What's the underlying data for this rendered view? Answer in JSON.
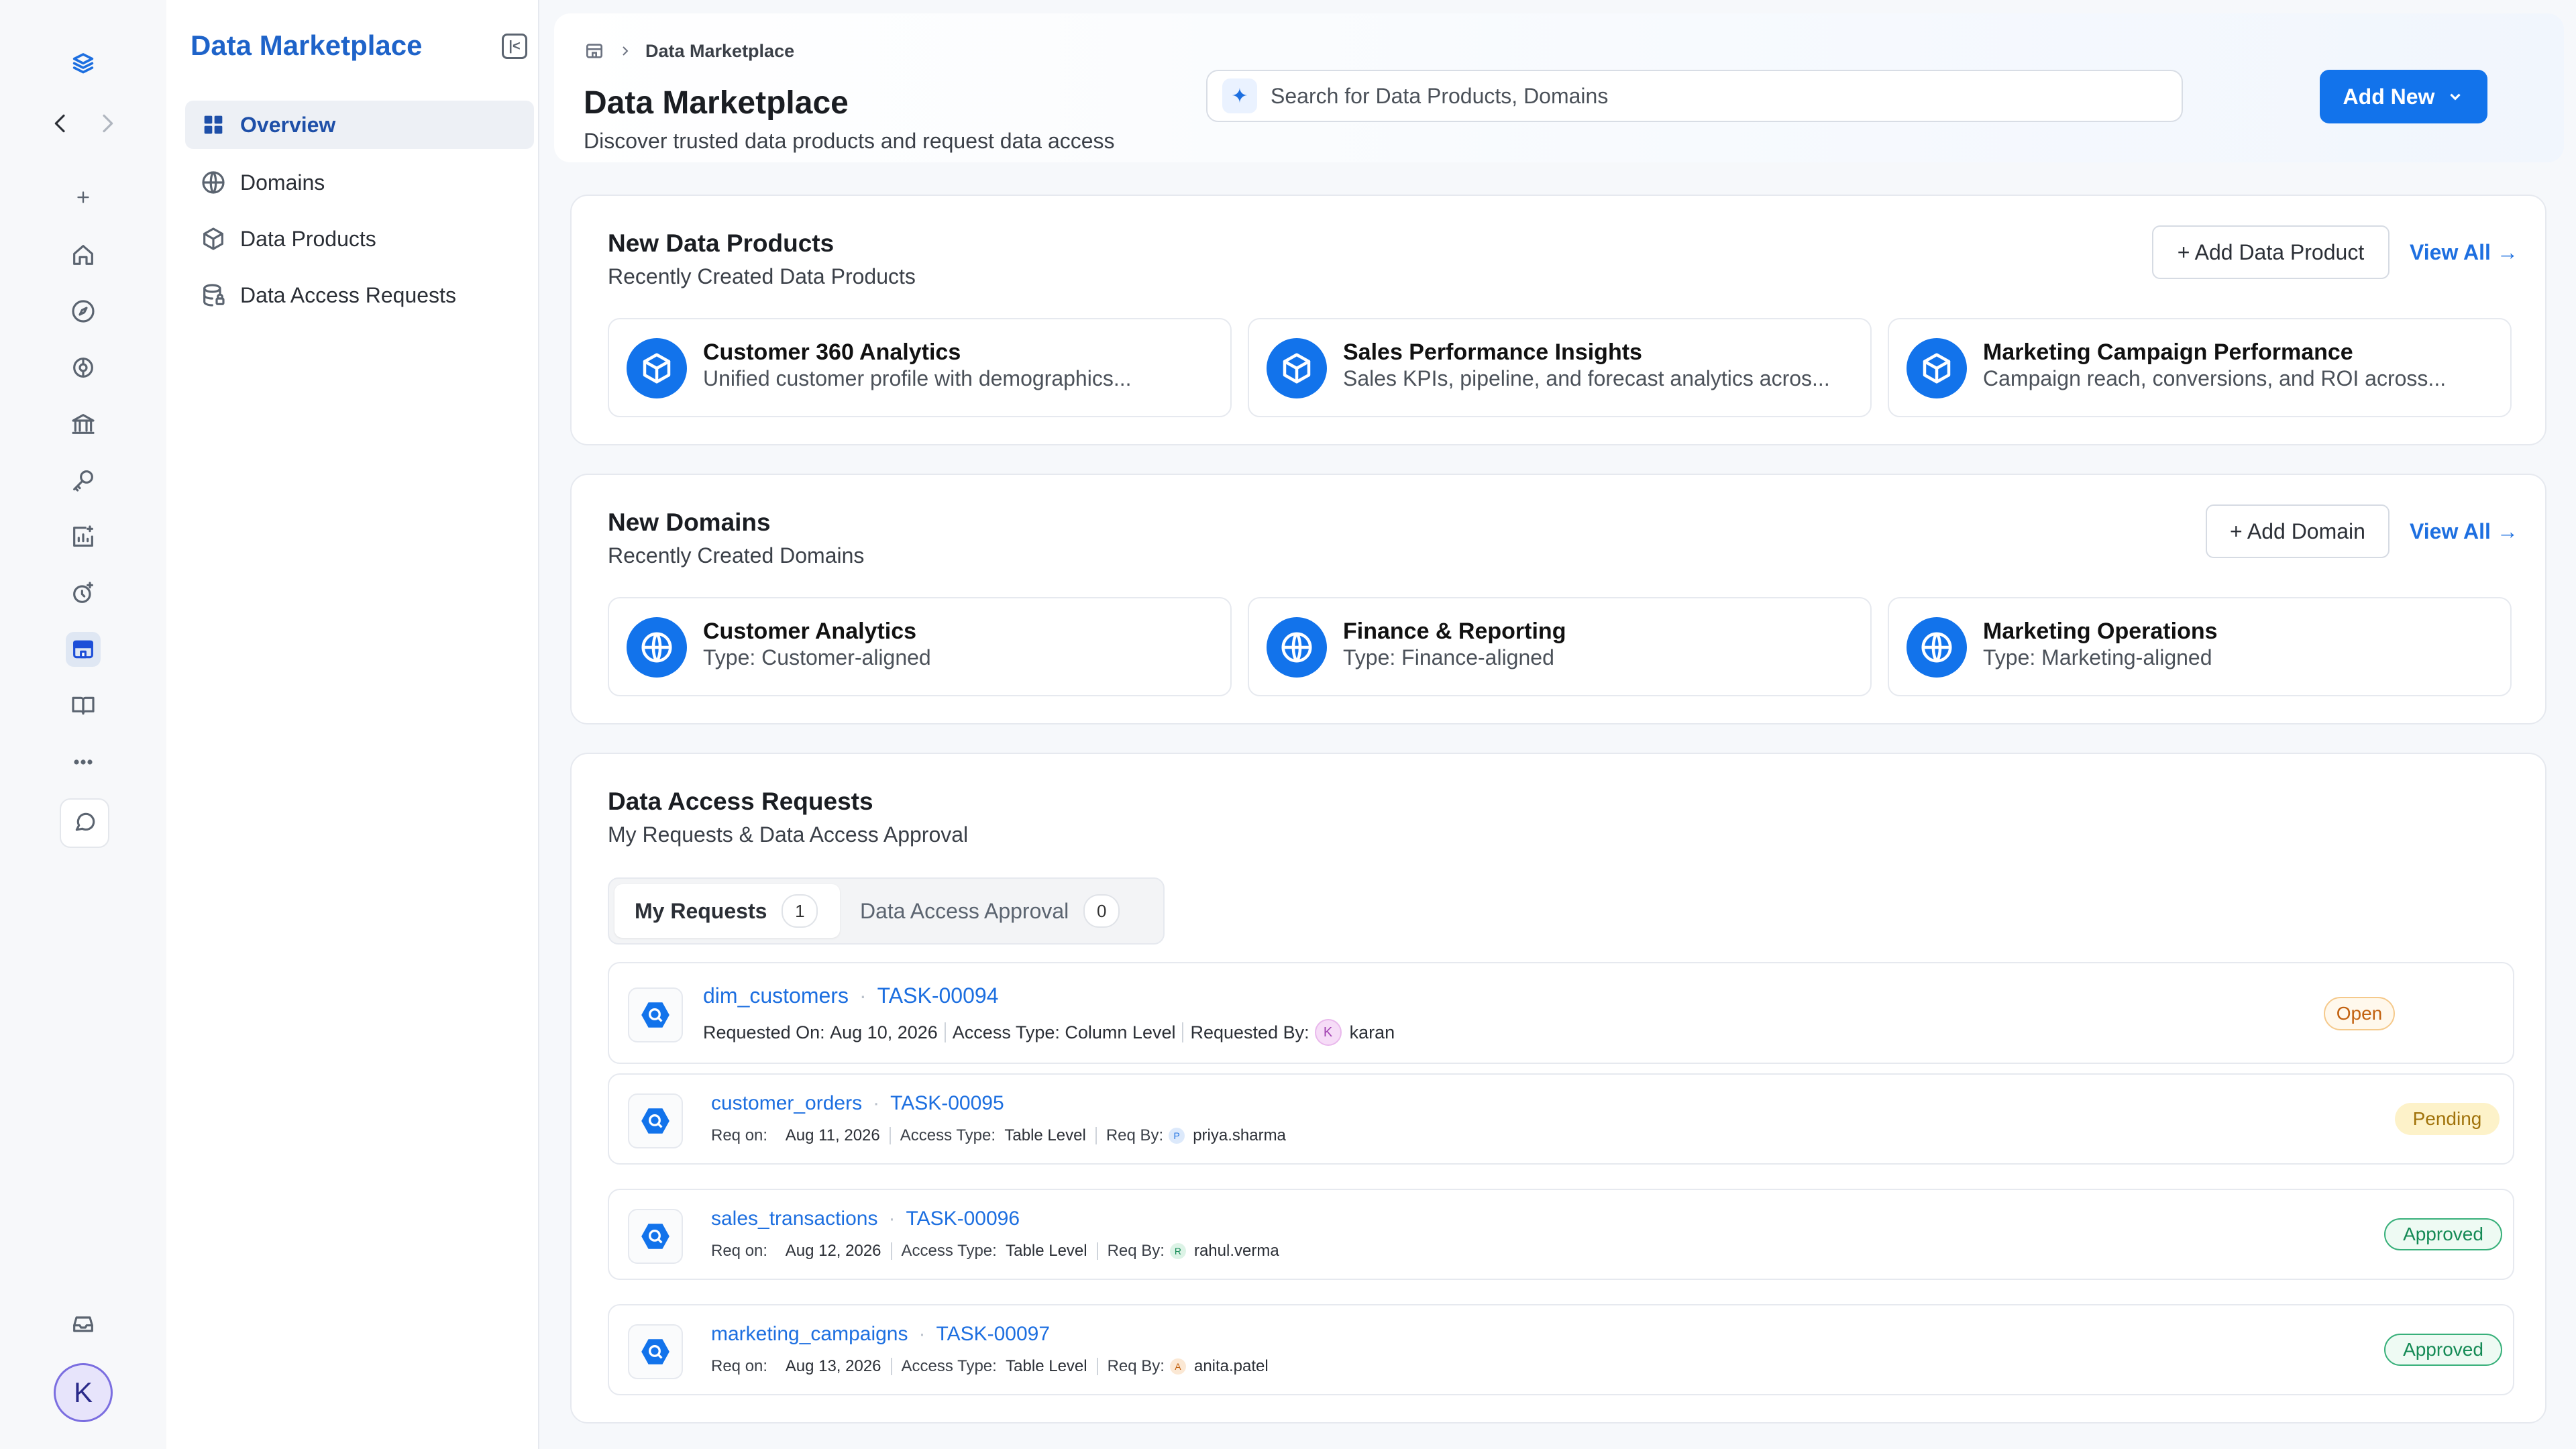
{
  "sidebar": {
    "title": "Data Marketplace",
    "items": [
      {
        "label": "Overview"
      },
      {
        "label": "Domains"
      },
      {
        "label": "Data Products"
      },
      {
        "label": "Data Access Requests"
      }
    ]
  },
  "rail": {
    "icons": [
      "logo-icon",
      "back-icon",
      "forward-icon",
      "plus-icon",
      "home-icon",
      "compass-icon",
      "governance-icon",
      "bank-icon",
      "key-icon",
      "insights-icon",
      "clock-spark-icon",
      "marketplace-icon",
      "book-icon",
      "more-icon",
      "chat-icon",
      "inbox-icon"
    ],
    "avatar_initial": "K"
  },
  "header": {
    "breadcrumb": "Data Marketplace",
    "title": "Data Marketplace",
    "subtitle": "Discover trusted data products and request data access",
    "search_placeholder": "Search for Data Products, Domains",
    "add_new_label": "Add New"
  },
  "products": {
    "title": "New Data Products",
    "subtitle": "Recently Created Data Products",
    "add_label": "+ Add Data Product",
    "view_all": "View All →",
    "items": [
      {
        "name": "Customer 360 Analytics",
        "desc": "Unified customer profile with demographics..."
      },
      {
        "name": "Sales Performance Insights",
        "desc": "Sales KPIs, pipeline, and forecast analytics acros..."
      },
      {
        "name": "Marketing Campaign Performance",
        "desc": "Campaign reach, conversions, and ROI across..."
      }
    ]
  },
  "domains": {
    "title": "New Domains",
    "subtitle": "Recently Created Domains",
    "add_label": "+ Add Domain",
    "view_all": "View All →",
    "items": [
      {
        "name": "Customer Analytics",
        "desc": "Type: Customer-aligned"
      },
      {
        "name": "Finance & Reporting",
        "desc": "Type: Finance-aligned"
      },
      {
        "name": "Marketing Operations",
        "desc": "Type: Marketing-aligned"
      }
    ]
  },
  "requests": {
    "title": "Data Access Requests",
    "subtitle": "My Requests & Data Access Approval",
    "tabs": [
      {
        "label": "My Requests",
        "count": "1"
      },
      {
        "label": "Data Access Approval",
        "count": "0"
      }
    ],
    "items": [
      {
        "asset": "dim_customers",
        "task": "TASK-00094",
        "date_label": "Requested On:",
        "date": "Aug 10, 2026",
        "access_label": "Access Type:",
        "access": "Column Level",
        "by_label": "Requested By:",
        "user": "karan",
        "user_initial": "K",
        "status": "Open"
      },
      {
        "asset": "customer_orders",
        "task": "TASK-00095",
        "date_label": "Req on:",
        "date": "Aug 11, 2026",
        "access_label": "Access Type:",
        "access": "Table Level",
        "by_label": "Req By:",
        "user": "priya.sharma",
        "user_initial": "P",
        "status": "Pending"
      },
      {
        "asset": "sales_transactions",
        "task": "TASK-00096",
        "date_label": "Req on:",
        "date": "Aug 12, 2026",
        "access_label": "Access Type:",
        "access": "Table Level",
        "by_label": "Req By:",
        "user": "rahul.verma",
        "user_initial": "R",
        "status": "Approved"
      },
      {
        "asset": "marketing_campaigns",
        "task": "TASK-00097",
        "date_label": "Req on:",
        "date": "Aug 13, 2026",
        "access_label": "Access Type:",
        "access": "Table Level",
        "by_label": "Req By:",
        "user": "anita.patel",
        "user_initial": "A",
        "status": "Approved"
      }
    ]
  },
  "colors": {
    "accent": "#1273eb",
    "brand_title": "#1e63c9",
    "open": "#c2610f",
    "pending": "#a0720a",
    "approved": "#148a55"
  }
}
